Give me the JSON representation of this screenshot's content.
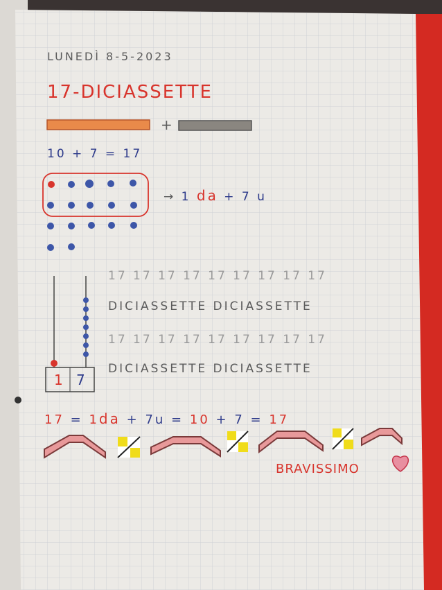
{
  "date": "LUNEDÌ 8-5-2023",
  "title": "17-DICIASSETTE",
  "plus_sign": "+",
  "sum_line": "10 + 7 = 17",
  "arrow_text": {
    "arrow": "→",
    "one": "1",
    "da": "da",
    "rest": "+ 7 u"
  },
  "abacus_digits": {
    "tens": "1",
    "units": "7"
  },
  "practice_rows": [
    "17 17 17 17 17 17 17 17 17",
    "DICIASSETTE DICIASSETTE",
    "17 17 17 17 17 17 17 17 17",
    "DICIASSETTE DICIASSETTE"
  ],
  "equation": {
    "part1": "17",
    "eq": "=",
    "one": "1",
    "da": "da",
    "plus": "+",
    "seven_u": "7u",
    "eq2": "=",
    "ten": "10",
    "plus2": "+",
    "seven": "7",
    "eq3": "=",
    "result": "17"
  },
  "praise": "BRAVISSIMO",
  "colors": {
    "paper": "#eceae6",
    "grid": "#c9ccd2",
    "ink_blue": "#2d3a8a",
    "ink_red": "#d8342c",
    "orange_bar": "#e98a4a",
    "gray_bar": "#8a8680",
    "notebook_cover": "#d42a22"
  }
}
